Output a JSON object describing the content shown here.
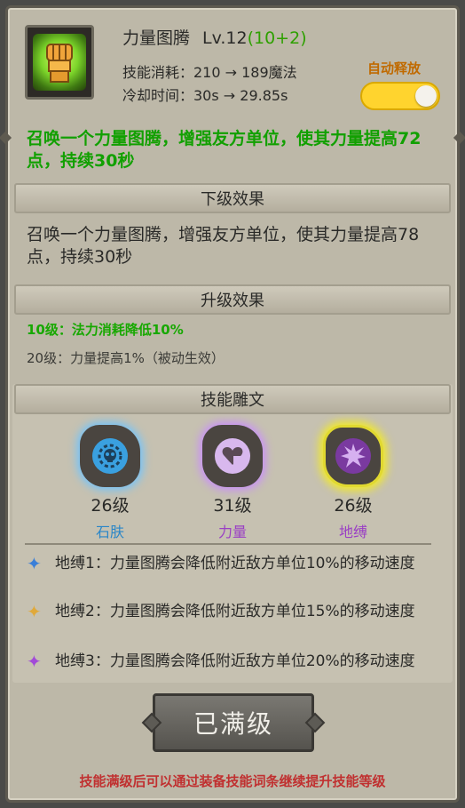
{
  "header": {
    "skill_name": "力量图腾",
    "level": "Lv.12",
    "level_bonus": "(10+2)",
    "cost_label": "技能消耗：210 → 189魔法",
    "cooldown_label": "冷却时间：30s → 29.85s",
    "auto_cast_label": "自动释放",
    "auto_cast_on": true,
    "icon": "fist-icon",
    "colors": {
      "bonus": "#2ea000",
      "toggle": "#ffd42e"
    }
  },
  "current_desc": "召唤一个力量图腾，增强友方单位，使其力量提高72点，持续30秒",
  "next_level": {
    "title": "下级效果",
    "desc": "召唤一个力量图腾，增强友方单位，使其力量提高78点，持续30秒"
  },
  "upgrade": {
    "title": "升级效果",
    "items": [
      {
        "text": "10级：法力消耗降低10%",
        "color": "#17a800"
      },
      {
        "text": "20级：力量提高1%（被动生效）",
        "color": "#3a3a36"
      }
    ]
  },
  "runes": {
    "title": "技能雕文",
    "items": [
      {
        "level": "26级",
        "name": "石肤",
        "name_color": "#2a86c8",
        "icon": "skull-gear-icon",
        "glow": "#6fc4ff"
      },
      {
        "level": "31级",
        "name": "力量",
        "name_color": "#9a3fc4",
        "icon": "heart-fist-icon",
        "glow": "#c98cff"
      },
      {
        "level": "26级",
        "name": "地缚",
        "name_color": "#9a3fc4",
        "icon": "burst-icon",
        "glow": "#f2ea2a"
      }
    ],
    "effects": [
      {
        "text": "地缚1：力量图腾会降低附近敌方单位10%的移动速度",
        "star_color": "#3a7fd8"
      },
      {
        "text": "地缚2：力量图腾会降低附近敌方单位15%的移动速度",
        "star_color": "#e0a93a"
      },
      {
        "text": "地缚3：力量图腾会降低附近敌方单位20%的移动速度",
        "star_color": "#a24ad8"
      }
    ]
  },
  "max_button": "已满级",
  "footer_note": "技能满级后可以通过装备技能词条继续提升技能等级"
}
